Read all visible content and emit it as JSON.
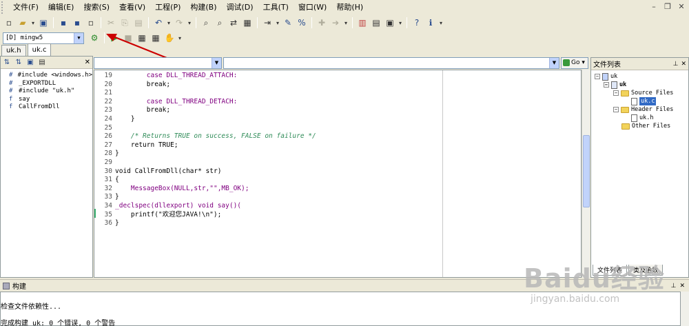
{
  "menu": {
    "items": [
      "文件(F)",
      "编辑(E)",
      "搜索(S)",
      "查看(V)",
      "工程(P)",
      "构建(B)",
      "调试(D)",
      "工具(T)",
      "窗口(W)",
      "帮助(H)"
    ]
  },
  "toolbar": {
    "compiler": "[D] mingw5"
  },
  "file_tabs": [
    "uk.h",
    "uk.c"
  ],
  "class_browser": {
    "items": [
      {
        "icon": "#",
        "label": "#include <windows.h>"
      },
      {
        "icon": "#",
        "label": "_EXPORTDLL"
      },
      {
        "icon": "#",
        "label": "#include \"uk.h\""
      },
      {
        "icon": "f",
        "label": "say"
      },
      {
        "icon": "f",
        "label": "CallFromDll"
      }
    ]
  },
  "editor": {
    "go_label": "Go",
    "lines": [
      {
        "n": "19",
        "text": "        case DLL_THREAD_ATTACH:"
      },
      {
        "n": "20",
        "text": "        break;"
      },
      {
        "n": "21",
        "text": ""
      },
      {
        "n": "22",
        "text": "        case DLL_THREAD_DETACH:"
      },
      {
        "n": "23",
        "text": "        break;"
      },
      {
        "n": "24",
        "text": "    }"
      },
      {
        "n": "25",
        "text": ""
      },
      {
        "n": "26",
        "text": "    /* Returns TRUE on success, FALSE on failure */"
      },
      {
        "n": "27",
        "text": "    return TRUE;"
      },
      {
        "n": "28",
        "text": "}"
      },
      {
        "n": "29",
        "text": ""
      },
      {
        "n": "30",
        "text": "void CallFromDll(char* str)"
      },
      {
        "n": "31",
        "text": "{"
      },
      {
        "n": "32",
        "text": "    MessageBox(NULL,str,\"\",MB_OK);"
      },
      {
        "n": "33",
        "text": "}"
      },
      {
        "n": "34",
        "text": "_declspec(dllexport) void say()("
      },
      {
        "n": "35",
        "text": "    printf(\"欢迎您JAVA!\\n\");"
      },
      {
        "n": "36",
        "text": "}"
      }
    ]
  },
  "file_list": {
    "title": "文件列表",
    "items": {
      "root": "uk",
      "project": "uk",
      "source_folder": "Source Files",
      "source_file": "uk.c",
      "header_folder": "Header Files",
      "header_file": "uk.h",
      "other_folder": "Other Files"
    },
    "tabs": [
      "文件列表",
      "类及函数"
    ]
  },
  "build": {
    "title": "构建",
    "lines": [
      "检查文件依赖性...",
      "完成构建 uk: 0 个错误, 0 个警告"
    ]
  },
  "watermark": {
    "logo": "Baidu经验",
    "url": "jingyan.baidu.com"
  },
  "colors": {
    "chrome": "#ece9d8",
    "selection": "#316ac5",
    "annotation": "#cc0000",
    "comment": "#2e8b57",
    "identifier": "#800080"
  }
}
